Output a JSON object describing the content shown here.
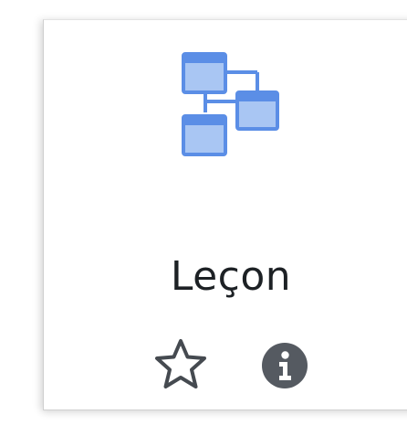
{
  "module": {
    "name": "Leçon",
    "icon": "lesson-flowchart-icon",
    "icon_color": "#5b8ee6",
    "icon_fill": "#a9c6f3"
  },
  "actions": {
    "favourite_icon": "star-outline-icon",
    "info_icon": "info-icon",
    "info_color": "#555a61"
  }
}
